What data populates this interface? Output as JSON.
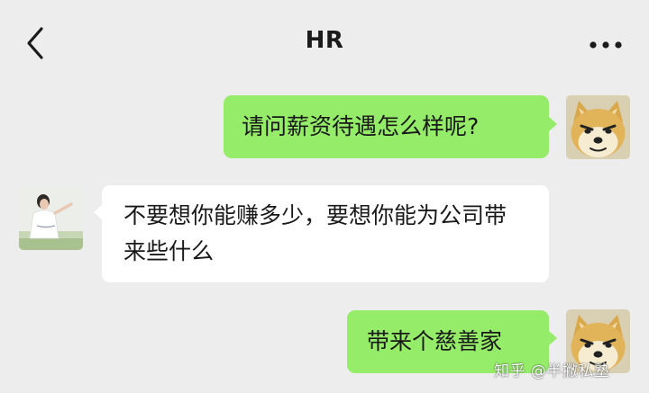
{
  "header": {
    "title": "HR",
    "back_icon": "chevron-left-icon",
    "more_icon": "ellipsis-icon"
  },
  "messages": [
    {
      "sender": "me",
      "text": "请问薪资待遇怎么样呢?"
    },
    {
      "sender": "hr",
      "text": "不要想你能赚多少，要想你能为公司带来些什么"
    },
    {
      "sender": "me",
      "text": "带来个慈善家"
    }
  ],
  "watermark": "知乎 @半撇私塾",
  "colors": {
    "background": "#ededed",
    "my_bubble": "#95ec69",
    "other_bubble": "#ffffff",
    "text": "#191919"
  }
}
